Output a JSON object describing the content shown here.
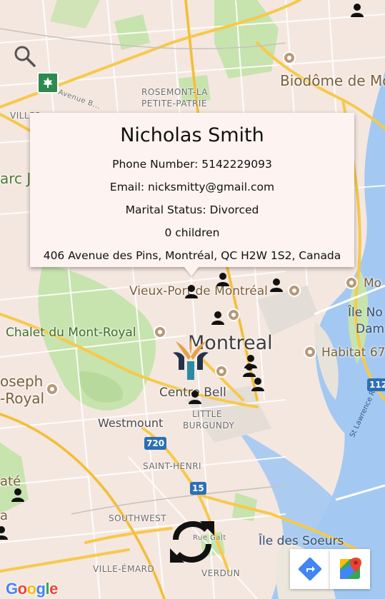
{
  "map": {
    "labels": {
      "rosemont": "ROSEMONT-LA",
      "petite_patrie": "PETITE-PATRIE",
      "biodome": "Biodôme de Mo",
      "villeray": "VILLER...",
      "parc_jarry": "arc Ja",
      "avenue_beaubien": "Avenue B...",
      "vieux_port": "Vieux-Port de Montréal",
      "mont_royal": "Chalet du Mont-Royal",
      "montreal": "Montreal",
      "joseph": "oseph",
      "royal": "-Royal",
      "centre_bell": "Centre Bell",
      "little_burgundy_1": "LITTLE",
      "little_burgundy_2": "BURGUNDY",
      "westmount": "Westmount",
      "saint_henri": "SAINT-HENRI",
      "southwest": "SOUTHWEST",
      "ville_emard": "VILLE-ÉMARD",
      "verdun": "VERDUN",
      "ile_des_soeurs": "Île des Soeurs",
      "ile_notre_dame_1": "Île No",
      "ile_notre_dame_2": "Dam",
      "habitat": "Habitat 67",
      "mo_right": "Mo",
      "st_lawrence": "St Lawrence River",
      "rue_galt": "Rue Galt",
      "lasalle": "até",
      "lasalle2": "a"
    },
    "shields": {
      "hwy_720": "720",
      "hwy_15": "15",
      "hwy_112": "112"
    }
  },
  "info_card": {
    "name": "Nicholas Smith",
    "phone": "Phone Number: 5142229093",
    "email": "Email: nicksmitty@gmail.com",
    "marital": "Marital Status: Divorced",
    "children": "0 children",
    "address": "406 Avenue des Pins, Montréal, QC H2W 1S2, Canada"
  },
  "icons": {
    "search": "search-icon",
    "refresh": "refresh-icon",
    "directions": "directions-icon",
    "google_maps": "google-maps-icon",
    "person_marker": "person-marker-icon",
    "app_logo": "family-logo-icon"
  },
  "google_logo": {
    "letters": [
      "G",
      "o",
      "o",
      "g",
      "l",
      "e"
    ],
    "colors": [
      "#4285f4",
      "#ea4335",
      "#fbbc05",
      "#4285f4",
      "#34a853",
      "#ea4335"
    ]
  },
  "colors": {
    "card_background": "#fdf3f0",
    "water": "#a3c9f2",
    "park": "#c7e3ae",
    "highway": "#f7c94a"
  }
}
